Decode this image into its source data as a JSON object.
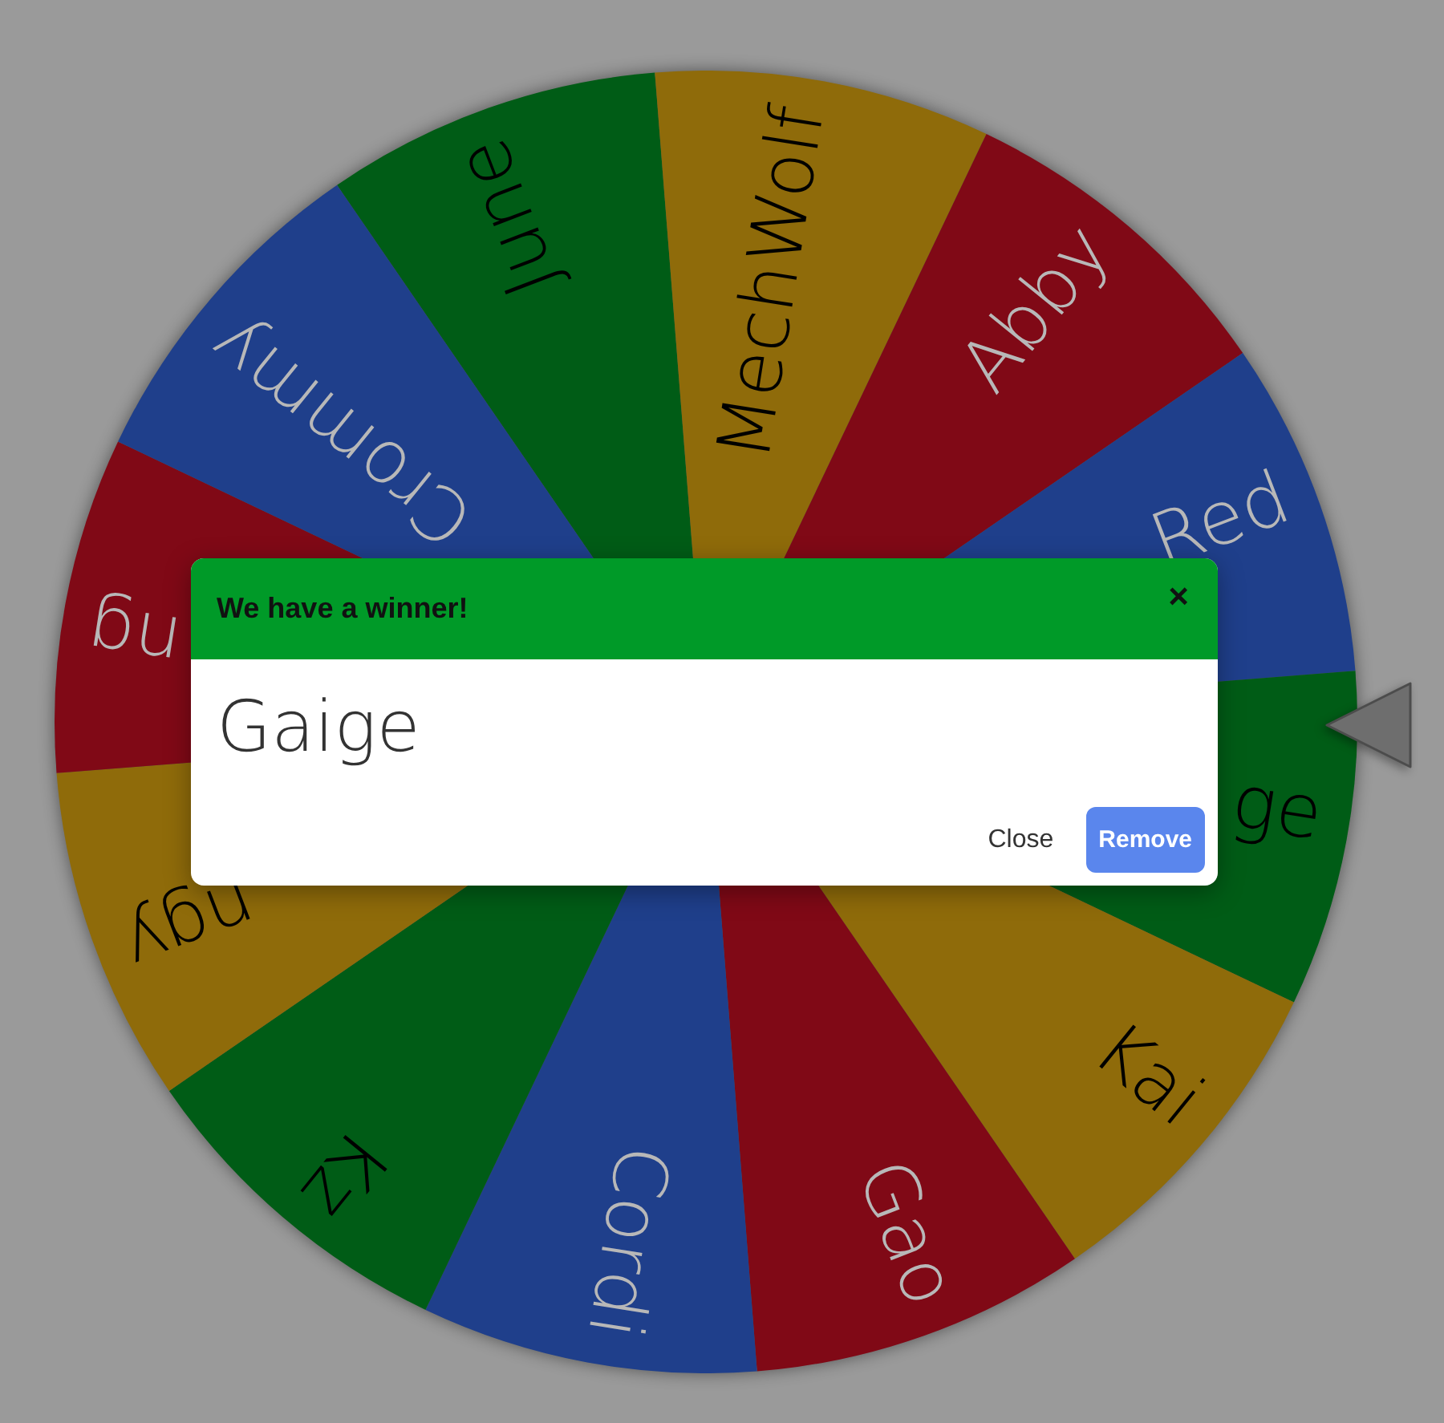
{
  "wheel": {
    "segments": [
      {
        "label": "June",
        "color": "#005c16"
      },
      {
        "label": "MechWolf",
        "color": "#8f6b0a"
      },
      {
        "label": "Abby",
        "color": "#800916"
      },
      {
        "label": "Red",
        "color": "#1f3f8b"
      },
      {
        "label": "ge",
        "color": "#005c16"
      },
      {
        "label": "Kai",
        "color": "#8f6b0a"
      },
      {
        "label": "Gao",
        "color": "#800916"
      },
      {
        "label": "Cordi",
        "color": "#1f3f8b"
      },
      {
        "label": "Kz",
        "color": "#005c16"
      },
      {
        "label": "ngy",
        "color": "#8f6b0a"
      },
      {
        "label": "ng",
        "color": "#800916"
      },
      {
        "label": "Crommy",
        "color": "#1f3f8b"
      }
    ]
  },
  "dialog": {
    "title": "We have a winner!",
    "close_symbol": "×",
    "winner": "Gaige",
    "buttons": [
      {
        "label": "Close",
        "kind": "text"
      },
      {
        "label": "Remove",
        "kind": "primary"
      }
    ]
  }
}
